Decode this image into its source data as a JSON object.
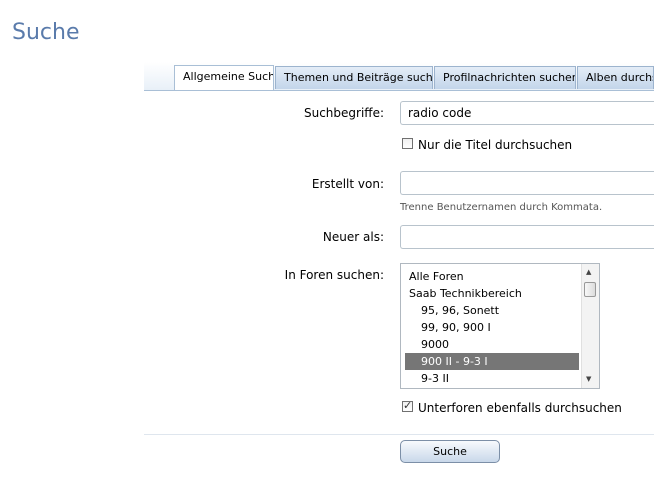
{
  "page": {
    "title": "Suche"
  },
  "tabs": [
    {
      "label": "Allgemeine Suche",
      "active": true
    },
    {
      "label": "Themen und Beiträge suchen",
      "active": false
    },
    {
      "label": "Profilnachrichten suchen",
      "active": false
    },
    {
      "label": "Alben durchsuchen",
      "active": false
    }
  ],
  "form": {
    "keywords_label": "Suchbegriffe:",
    "keywords_value": "radio code",
    "titles_only_label": "Nur die Titel durchsuchen",
    "titles_only_checked": false,
    "created_by_label": "Erstellt von:",
    "created_by_value": "",
    "created_by_hint": "Trenne Benutzernamen durch Kommata.",
    "newer_than_label": "Neuer als:",
    "newer_than_value": "",
    "forums_label": "In Foren suchen:",
    "forums": [
      {
        "label": "Alle Foren",
        "indent": false,
        "selected": false
      },
      {
        "label": "Saab Technikbereich",
        "indent": false,
        "selected": false
      },
      {
        "label": "95, 96, Sonett",
        "indent": true,
        "selected": false
      },
      {
        "label": "99, 90, 900 I",
        "indent": true,
        "selected": false
      },
      {
        "label": "9000",
        "indent": true,
        "selected": false
      },
      {
        "label": "900 II - 9-3 I",
        "indent": true,
        "selected": true
      },
      {
        "label": "9-3 II",
        "indent": true,
        "selected": false
      }
    ],
    "subforums_label": "Unterforen ebenfalls durchsuchen",
    "subforums_checked": true,
    "submit_label": "Suche"
  },
  "icons": {
    "scroll_up": "▲",
    "scroll_down": "▼"
  }
}
